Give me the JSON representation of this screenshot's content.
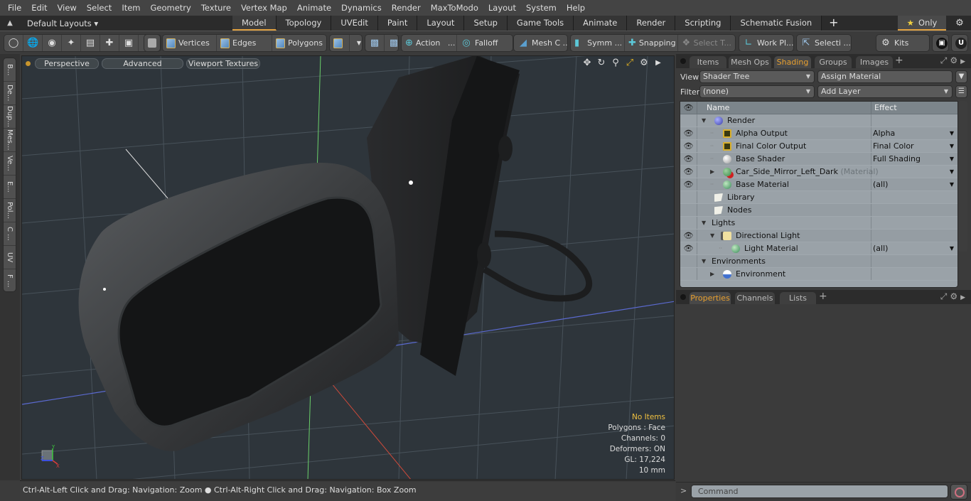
{
  "menu": [
    "File",
    "Edit",
    "View",
    "Select",
    "Item",
    "Geometry",
    "Texture",
    "Vertex Map",
    "Animate",
    "Dynamics",
    "Render",
    "MaxToModo",
    "Layout",
    "System",
    "Help"
  ],
  "layoutbar": {
    "layouts_label": "Default Layouts ▾",
    "tabs": [
      "Model",
      "Topology",
      "UVEdit",
      "Paint",
      "Layout",
      "Setup",
      "Game Tools",
      "Animate",
      "Render",
      "Scripting",
      "Schematic Fusion"
    ],
    "active_tab": "Model",
    "add_tab": "+",
    "only_label": "Only",
    "accent_color": "#e0a040"
  },
  "toolbar": {
    "vertices": "Vertices",
    "edges": "Edges",
    "polygons": "Polygons",
    "action": "Action",
    "action_more": "...",
    "falloff": "Falloff",
    "mesh_constraints": "Mesh C ...",
    "symmetry": "Symm ...",
    "snapping": "Snapping",
    "select_through": "Select T...",
    "work_plane": "Work Pl...",
    "selection_sets": "Selecti ...",
    "kits": "Kits"
  },
  "left_strip": [
    "B...",
    "De...",
    "Dup...",
    "Mes...",
    "Ve...",
    "E...",
    "Pol...",
    "C ...",
    "UV",
    "F ..."
  ],
  "viewport": {
    "view_mode": "Perspective",
    "shading": "Advanced",
    "textures": "Viewport Textures",
    "info": {
      "selection": "No Items",
      "mode": "Polygons : Face",
      "channels": "Channels: 0",
      "deformers": "Deformers: ON",
      "gl": "GL: 17,224",
      "grid": "10 mm"
    },
    "axes": {
      "x": "X",
      "y": "Y",
      "z": "Z"
    }
  },
  "status": {
    "hint": "Ctrl-Alt-Left Click and Drag: Navigation: Zoom ● Ctrl-Alt-Right Click and Drag: Navigation: Box Zoom"
  },
  "right_panel": {
    "top_tabs": [
      "Items",
      "Mesh Ops",
      "Shading",
      "Groups",
      "Images"
    ],
    "active_top_tab": "Shading",
    "view_label": "View",
    "view_value": "Shader Tree",
    "assign_material": "Assign Material",
    "filter_label": "Filter",
    "filter_value": "(none)",
    "add_layer": "Add Layer",
    "tree_headers": {
      "name": "Name",
      "effect": "Effect"
    },
    "tree": [
      {
        "name": "Render",
        "sub": "",
        "effect": "",
        "eye": false,
        "level": 0,
        "twisty": "open",
        "icon": "render-sphere-icon",
        "dropdown": false
      },
      {
        "name": "Alpha Output",
        "sub": "",
        "effect": "Alpha",
        "eye": true,
        "level": 1,
        "twisty": "leaf",
        "icon": "render-output-icon",
        "dropdown": true
      },
      {
        "name": "Final Color Output",
        "sub": "",
        "effect": "Final Color",
        "eye": true,
        "level": 1,
        "twisty": "leaf",
        "icon": "render-output-icon",
        "dropdown": true
      },
      {
        "name": "Base Shader",
        "sub": "",
        "effect": "Full Shading",
        "eye": true,
        "level": 1,
        "twisty": "leaf",
        "icon": "shader-sphere-icon",
        "dropdown": true
      },
      {
        "name": "Car_Side_Mirror_Left_Dark",
        "sub": "(Material)",
        "effect": "",
        "eye": true,
        "level": 1,
        "twisty": "closed",
        "icon": "material-group-icon",
        "dropdown": true
      },
      {
        "name": "Base Material",
        "sub": "",
        "effect": "(all)",
        "eye": true,
        "level": 1,
        "twisty": "leaf",
        "icon": "material-sphere-icon",
        "dropdown": true
      },
      {
        "name": "Library",
        "sub": "",
        "effect": "",
        "eye": false,
        "level": 0,
        "twisty": "none",
        "icon": "folder-icon",
        "dropdown": false
      },
      {
        "name": "Nodes",
        "sub": "",
        "effect": "",
        "eye": false,
        "level": 0,
        "twisty": "none",
        "icon": "folder-icon",
        "dropdown": false
      },
      {
        "name": "Lights",
        "sub": "",
        "effect": "",
        "eye": false,
        "level": 0,
        "twisty": "open",
        "icon": "",
        "dropdown": false
      },
      {
        "name": "Directional Light",
        "sub": "",
        "effect": "",
        "eye": true,
        "level": 1,
        "twisty": "open",
        "icon": "directional-light-icon",
        "dropdown": false
      },
      {
        "name": "Light Material",
        "sub": "",
        "effect": "(all)",
        "eye": true,
        "level": 2,
        "twisty": "leaf",
        "icon": "material-sphere-icon",
        "dropdown": true
      },
      {
        "name": "Environments",
        "sub": "",
        "effect": "",
        "eye": false,
        "level": 0,
        "twisty": "open",
        "icon": "",
        "dropdown": false
      },
      {
        "name": "Environment",
        "sub": "",
        "effect": "",
        "eye": false,
        "level": 1,
        "twisty": "closed",
        "icon": "environment-icon",
        "dropdown": false
      }
    ],
    "bottom_tabs": [
      "Properties",
      "Channels",
      "Lists"
    ],
    "active_bottom_tab": "Properties",
    "command_prompt": ">",
    "command_placeholder": "Command"
  }
}
